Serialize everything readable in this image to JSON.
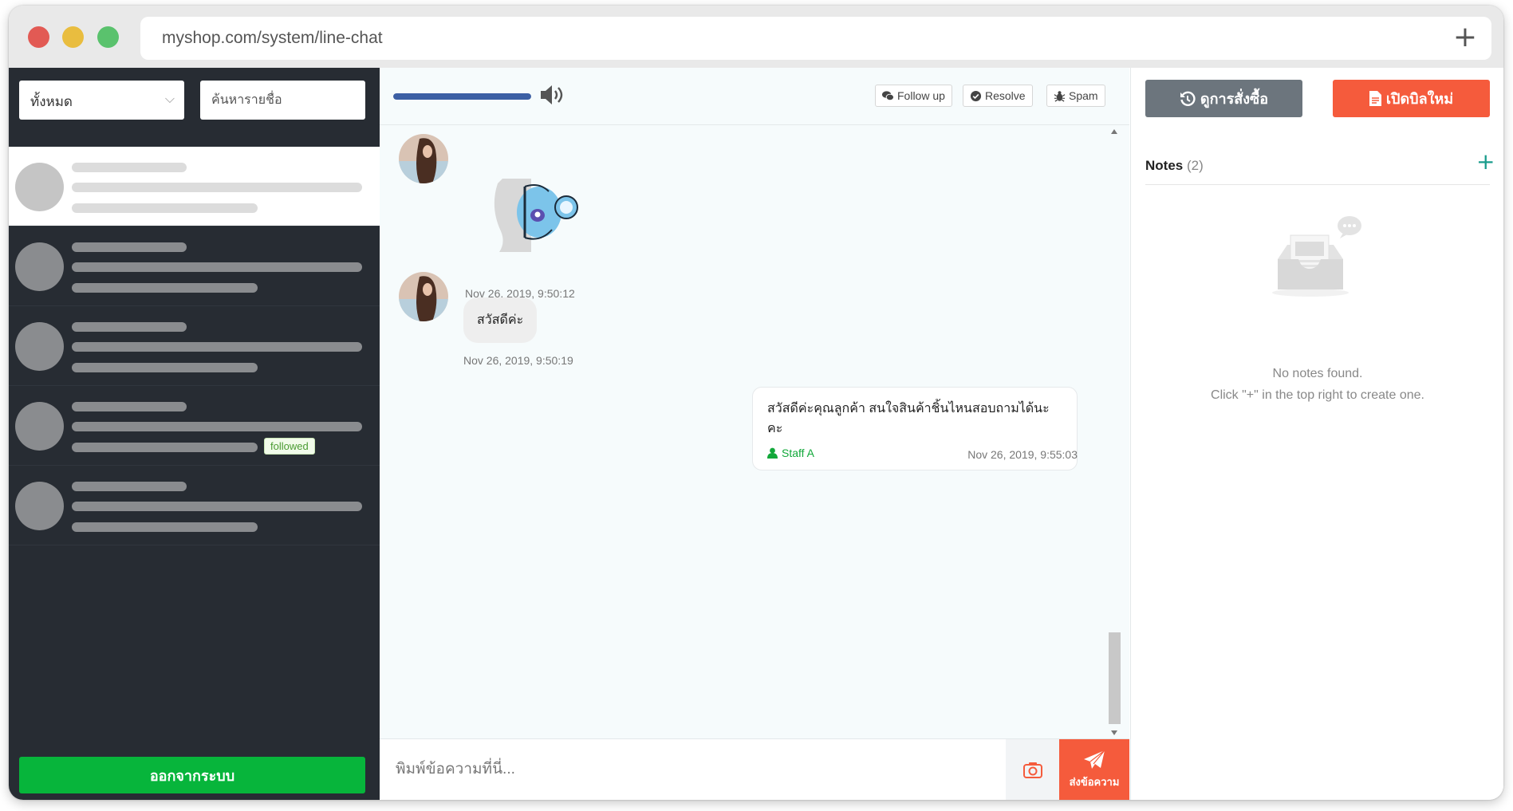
{
  "browser": {
    "url": "myshop.com/system/line-chat",
    "new_tab_glyph": "+"
  },
  "sidebar": {
    "filter": {
      "selected": "ทั้งหมด"
    },
    "search": {
      "placeholder": "ค้นหารายชื่อ"
    },
    "followed_badge": "followed",
    "logout_label": "ออกจากระบบ"
  },
  "chat": {
    "audio_progress": 1.0,
    "toolbar": {
      "follow_up": "Follow up",
      "resolve": "Resolve",
      "spam": "Spam"
    },
    "messages": [
      {
        "from": "customer",
        "type": "sticker",
        "time": "Nov 26, 2019, 9:50:12"
      },
      {
        "from": "customer",
        "type": "text",
        "text": "สวัสดีค่ะ",
        "time": "Nov 26, 2019, 9:50:19"
      },
      {
        "from": "staff",
        "type": "text",
        "text": "สวัสดีค่ะคุณลูกค้า สนใจสินค้าชิ้นไหนสอบถามได้นะคะ",
        "staff_name": "Staff A",
        "time": "Nov 26, 2019, 9:55:03"
      }
    ],
    "composer": {
      "placeholder": "พิมพ์ข้อความที่นี่...",
      "send_label": "ส่งข้อความ"
    }
  },
  "panel": {
    "orders_button": "ดูการสั่งซื้อ",
    "new_bill_button": "เปิดบิลใหม่",
    "notes_title": "Notes",
    "notes_count": "(2)",
    "add_glyph": "+",
    "empty_line1": "No notes found.",
    "empty_line2": "Click \"+\" in the top right to create one."
  },
  "colors": {
    "sidebar_bg": "#272c33",
    "logout_green": "#07b53b",
    "accent_orange": "#f55b3c",
    "gray_button": "#6c757d",
    "staff_green": "#12a83a",
    "progress_blue": "#3c5fa4"
  },
  "icons": [
    "search-icon",
    "chevron-down-icon",
    "speaker-icon",
    "comments-icon",
    "check-circle-icon",
    "bug-icon",
    "user-icon",
    "camera-icon",
    "paper-plane-icon",
    "history-icon",
    "file-invoice-icon",
    "plus-icon",
    "inbox-empty-icon"
  ]
}
